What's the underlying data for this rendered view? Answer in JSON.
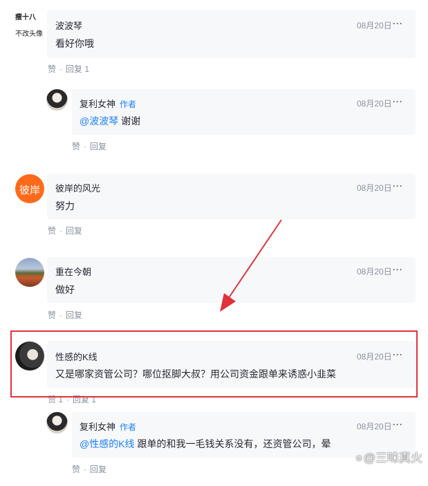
{
  "comments": [
    {
      "username": "波波琴",
      "date": "08月20日",
      "more": "···",
      "text": "看好你哦",
      "avatar_text_1": "瘦十八",
      "avatar_text_2": "不改头像",
      "like": "赞",
      "reply": "回复 1",
      "reply_item": {
        "username": "复利女神",
        "author_tag": "作者",
        "date": "08月20日",
        "more": "···",
        "mention": "@波波琴",
        "text": " 谢谢",
        "like": "赞",
        "reply": "回复"
      }
    },
    {
      "username": "彼岸的风光",
      "date": "08月20日",
      "more": "···",
      "text": "努力",
      "avatar_text": "彼岸",
      "like": "赞",
      "reply": "回复"
    },
    {
      "username": "重在今朝",
      "date": "08月20日",
      "more": "···",
      "text": "做好",
      "like": "赞",
      "reply": "回复"
    },
    {
      "username": "性感的K线",
      "date": "08月20日",
      "more": "···",
      "text": "又是哪家资管公司？哪位抠脚大叔？用公司资金跟单来诱惑小韭菜",
      "like": "赞 1",
      "reply": "回复 1",
      "reply_item": {
        "username": "复利女神",
        "author_tag": "作者",
        "date": "08月20日",
        "more": "···",
        "mention": "@性感的K线",
        "text": " 跟单的和我一毛钱关系没有，还资管公司，晕",
        "like": "赞",
        "reply": "回复"
      }
    }
  ],
  "watermark": "@三味真火",
  "colors": {
    "bubble_bg": "#f7f8fa",
    "mention": "#1e80ff",
    "highlight_border": "#e1323c",
    "avatar_orange": "#ff6a1a"
  }
}
